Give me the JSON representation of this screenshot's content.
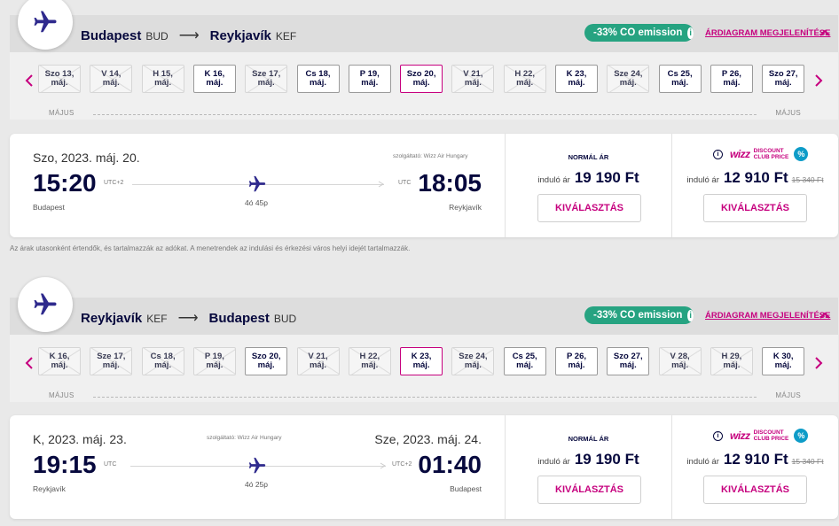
{
  "outbound": {
    "from_city": "Budapest",
    "from_code": "BUD",
    "to_city": "Reykjavík",
    "to_code": "KEF",
    "co2_label": "-33% CO emission",
    "fare_chart_label": "ÁRDIAGRAM MEGJELENÍTÉSE",
    "month_label": "MÁJUS",
    "dates": [
      {
        "day": "Szo 13,",
        "month": "máj.",
        "state": "disabled"
      },
      {
        "day": "V 14,",
        "month": "máj.",
        "state": "disabled"
      },
      {
        "day": "H 15,",
        "month": "máj.",
        "state": "disabled"
      },
      {
        "day": "K 16,",
        "month": "máj.",
        "state": "available"
      },
      {
        "day": "Sze 17,",
        "month": "máj.",
        "state": "disabled"
      },
      {
        "day": "Cs 18,",
        "month": "máj.",
        "state": "available"
      },
      {
        "day": "P 19,",
        "month": "máj.",
        "state": "available"
      },
      {
        "day": "Szo 20,",
        "month": "máj.",
        "state": "selected"
      },
      {
        "day": "V 21,",
        "month": "máj.",
        "state": "disabled"
      },
      {
        "day": "H 22,",
        "month": "máj.",
        "state": "disabled"
      },
      {
        "day": "K 23,",
        "month": "máj.",
        "state": "available"
      },
      {
        "day": "Sze 24,",
        "month": "máj.",
        "state": "disabled"
      },
      {
        "day": "Cs 25,",
        "month": "máj.",
        "state": "available"
      },
      {
        "day": "P 26,",
        "month": "máj.",
        "state": "available"
      },
      {
        "day": "Szo 27,",
        "month": "máj.",
        "state": "available"
      }
    ],
    "flight": {
      "dep_date": "Szo, 2023. máj. 20.",
      "dep_time": "15:20",
      "dep_utc": "UTC+2",
      "dep_city": "Budapest",
      "operator": "szolgáltató: Wizz Air Hungary",
      "duration": "4ó 45p",
      "arr_date": "",
      "arr_time": "18:05",
      "arr_utc": "UTC",
      "arr_city": "Reykjavík"
    },
    "normal_price": {
      "title": "NORMÁL ÁR",
      "from": "induló ár",
      "amount": "19 190 Ft",
      "button": "KIVÁLASZTÁS"
    },
    "club_price": {
      "logo": "wizz",
      "label_line1": "DISCOUNT",
      "label_line2": "CLUB PRICE",
      "from": "induló ár",
      "amount": "12 910 Ft",
      "old_amount": "15 340 Ft",
      "button": "KIVÁLASZTÁS"
    }
  },
  "disclaimer": "Az árak utasonként értendők, és tartalmazzák az adókat. A menetrendek az indulási és érkezési város helyi idejét tartalmazzák.",
  "return": {
    "from_city": "Reykjavík",
    "from_code": "KEF",
    "to_city": "Budapest",
    "to_code": "BUD",
    "co2_label": "-33% CO emission",
    "fare_chart_label": "ÁRDIAGRAM MEGJELENÍTÉSE",
    "month_label": "MÁJUS",
    "dates": [
      {
        "day": "K 16,",
        "month": "máj.",
        "state": "disabled"
      },
      {
        "day": "Sze 17,",
        "month": "máj.",
        "state": "disabled"
      },
      {
        "day": "Cs 18,",
        "month": "máj.",
        "state": "disabled"
      },
      {
        "day": "P 19,",
        "month": "máj.",
        "state": "disabled"
      },
      {
        "day": "Szo 20,",
        "month": "máj.",
        "state": "available"
      },
      {
        "day": "V 21,",
        "month": "máj.",
        "state": "disabled"
      },
      {
        "day": "H 22,",
        "month": "máj.",
        "state": "disabled"
      },
      {
        "day": "K 23,",
        "month": "máj.",
        "state": "selected"
      },
      {
        "day": "Sze 24,",
        "month": "máj.",
        "state": "disabled"
      },
      {
        "day": "Cs 25,",
        "month": "máj.",
        "state": "available"
      },
      {
        "day": "P 26,",
        "month": "máj.",
        "state": "available"
      },
      {
        "day": "Szo 27,",
        "month": "máj.",
        "state": "available"
      },
      {
        "day": "V 28,",
        "month": "máj.",
        "state": "disabled"
      },
      {
        "day": "H 29,",
        "month": "máj.",
        "state": "disabled"
      },
      {
        "day": "K 30,",
        "month": "máj.",
        "state": "available"
      }
    ],
    "flight": {
      "dep_date": "K, 2023. máj. 23.",
      "dep_time": "19:15",
      "dep_utc": "UTC",
      "dep_city": "Reykjavík",
      "operator": "szolgáltató: Wizz Air Hungary",
      "duration": "4ó 25p",
      "arr_date": "Sze, 2023. máj. 24.",
      "arr_time": "01:40",
      "arr_utc": "UTC+2",
      "arr_city": "Budapest"
    },
    "normal_price": {
      "title": "NORMÁL ÁR",
      "from": "induló ár",
      "amount": "19 190 Ft",
      "button": "KIVÁLASZTÁS"
    },
    "club_price": {
      "logo": "wizz",
      "label_line1": "DISCOUNT",
      "label_line2": "CLUB PRICE",
      "from": "induló ár",
      "amount": "12 910 Ft",
      "old_amount": "15 340 Ft",
      "button": "KIVÁLASZTÁS"
    }
  },
  "colors": {
    "brand_navy": "#06083d",
    "brand_magenta": "#c6007e",
    "co2_green": "#26a381",
    "club_badge_blue": "#0e9cc8"
  }
}
